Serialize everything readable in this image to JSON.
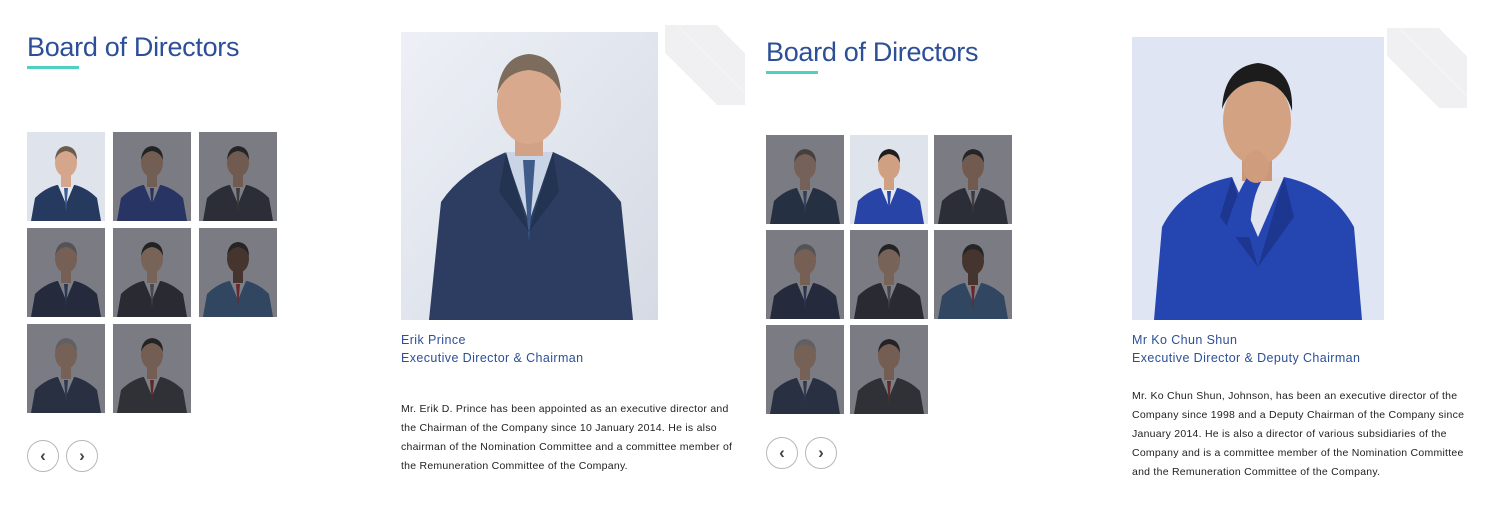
{
  "panels": [
    {
      "heading": "Board of Directors",
      "selected_index": 0,
      "profile": {
        "name": "Erik Prince",
        "title": "Executive Director & Chairman",
        "bio": "Mr. Erik D. Prince has been appointed as an executive director and the Chairman of the Company since 10 January 2014. He is also chairman of the Nomination Committee and a committee member of the Remuneration Committee of the Company."
      },
      "nav": {
        "prev_icon": "‹",
        "next_icon": "›"
      }
    },
    {
      "heading": "Board of Directors",
      "selected_index": 1,
      "profile": {
        "name": "Mr Ko Chun Shun",
        "title": "Executive Director & Deputy Chairman",
        "bio": "Mr. Ko Chun Shun, Johnson, has been an executive director of the Company since 1998 and a Deputy Chairman of the Company since January 2014. He is also a director of various subsidiaries of the Company and is a committee member of the Nomination Committee and the Remuneration Committee of the Company."
      },
      "nav": {
        "prev_icon": "‹",
        "next_icon": "›"
      }
    }
  ],
  "colors": {
    "heading": "#2d4f98",
    "accent_underline": "#4fd0c0",
    "text": "#222222",
    "photo_background": "#dfe4ef"
  },
  "thumbnails": [
    {
      "suit": "#253a5e",
      "tie": "#3b5f93",
      "skin": "#d6a68c",
      "hair": "#6b5c4e"
    },
    {
      "suit": "#2744a6",
      "tie": "#2744a6",
      "skin": "#cfa081",
      "hair": "#1e1e1e"
    },
    {
      "suit": "#2f3544",
      "tie": "#555555",
      "skin": "#c99a7b",
      "hair": "#222222"
    },
    {
      "suit": "#22304e",
      "tie": "#2b4a85",
      "skin": "#d4a587",
      "hair": "#8a8a8a"
    },
    {
      "suit": "#2a2e38",
      "tie": "#6e6e78",
      "skin": "#d7aa8b",
      "hair": "#1d1d1d"
    },
    {
      "suit": "#3c6a9e",
      "tie": "#b3282b",
      "skin": "#6b4630",
      "hair": "#222222"
    },
    {
      "suit": "#2c3a5a",
      "tie": "#334e86",
      "skin": "#d6a689",
      "hair": "#a5a5a5"
    },
    {
      "suit": "#3a3d44",
      "tie": "#a22a2c",
      "skin": "#d0a084",
      "hair": "#1d1d1d"
    }
  ]
}
